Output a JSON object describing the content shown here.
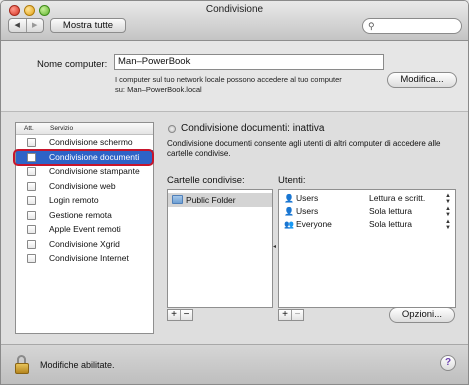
{
  "window": {
    "title": "Condivisione",
    "show_all_label": "Mostra tutte",
    "nav_back": "◀",
    "nav_forward": "▶",
    "search_placeholder": ""
  },
  "computer": {
    "name_label": "Nome computer:",
    "name_value": "Man–PowerBook",
    "note_line1": "I computer sul tuo network locale possono accedere al tuo computer",
    "note_line2": "su: Man–PowerBook.local",
    "edit_button": "Modifica..."
  },
  "services": {
    "header_on": "Att.",
    "header_service": "Servizio",
    "items": [
      {
        "label": "Condivisione schermo",
        "checked": false,
        "selected": false
      },
      {
        "label": "Condivisione documenti",
        "checked": false,
        "selected": true
      },
      {
        "label": "Condivisione stampante",
        "checked": false,
        "selected": false
      },
      {
        "label": "Condivisione web",
        "checked": false,
        "selected": false
      },
      {
        "label": "Login remoto",
        "checked": false,
        "selected": false
      },
      {
        "label": "Gestione remota",
        "checked": false,
        "selected": false
      },
      {
        "label": "Apple Event remoti",
        "checked": false,
        "selected": false
      },
      {
        "label": "Condivisione Xgrid",
        "checked": false,
        "selected": false
      },
      {
        "label": "Condivisione Internet",
        "checked": false,
        "selected": false
      }
    ]
  },
  "detail": {
    "status": "Condivisione documenti: inattiva",
    "description": "Condivisione documenti consente agli utenti di altri computer di accedere alle cartelle condivise.",
    "folders_label": "Cartelle condivise:",
    "users_label": "Utenti:",
    "folders": [
      "Public Folder"
    ],
    "users": [
      {
        "icon": "single-user-icon",
        "name": "Users",
        "permission": "Lettura e scritt."
      },
      {
        "icon": "single-user-icon",
        "name": "Users",
        "permission": "Sola lettura"
      },
      {
        "icon": "group-users-icon",
        "name": "Everyone",
        "permission": "Sola lettura"
      }
    ],
    "plus": "+",
    "minus": "−",
    "options_button": "Opzioni..."
  },
  "footer": {
    "lock_text": "Modifiche abilitate.",
    "help": "?"
  }
}
